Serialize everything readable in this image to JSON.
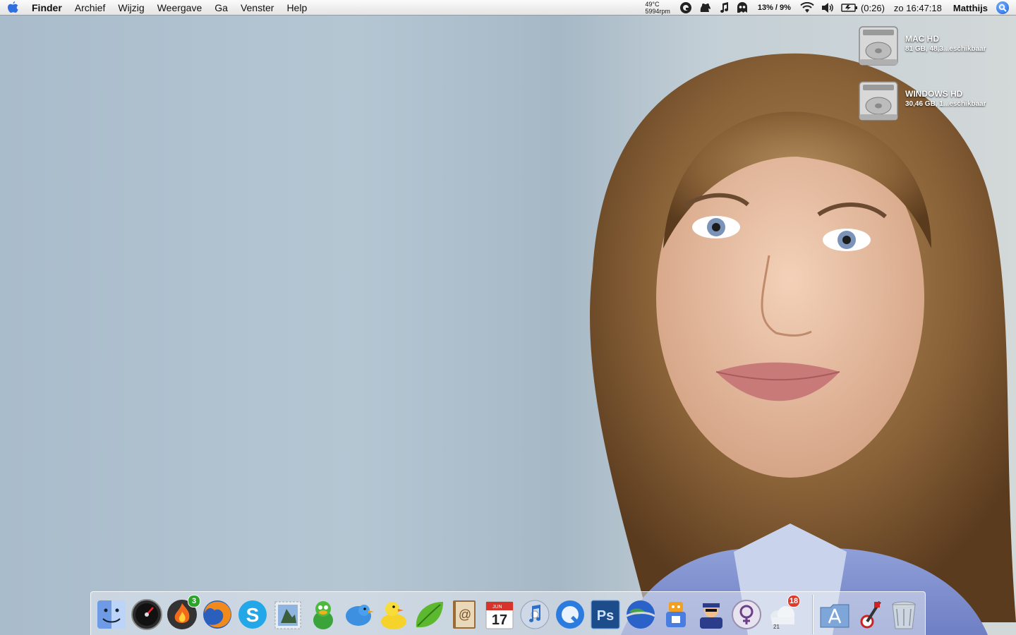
{
  "menubar": {
    "app_name": "Finder",
    "menus": [
      "Archief",
      "Wijzig",
      "Weergave",
      "Ga",
      "Venster",
      "Help"
    ],
    "temperature": "49°C",
    "fan_speed": "5994rpm",
    "cpu": "13% / 9%",
    "battery": "(0:26)",
    "clock": "zo 16:47:18",
    "user": "Matthijs",
    "status_icons": [
      "qsync-icon",
      "growl-icon",
      "music-note-icon",
      "ghost-icon",
      "wifi-icon",
      "volume-icon",
      "battery-icon"
    ]
  },
  "desktop": {
    "drives": [
      {
        "name": "MAC HD",
        "info": "81 GB, 48,3...eschikbaar"
      },
      {
        "name": "WINDOWS HD",
        "info": "30,46 GB, 1...eschikbaar"
      }
    ]
  },
  "dock": {
    "apps": [
      {
        "name": "finder",
        "icon": "finder-icon",
        "running": true
      },
      {
        "name": "dashboard",
        "icon": "dashboard-icon",
        "running": true
      },
      {
        "name": "cyberduck-fire",
        "icon": "fire-icon",
        "running": true,
        "badge": "3"
      },
      {
        "name": "firefox",
        "icon": "firefox-icon",
        "running": true
      },
      {
        "name": "skype",
        "icon": "skype-icon",
        "running": true
      },
      {
        "name": "mail-stamp",
        "icon": "stamp-icon",
        "running": true
      },
      {
        "name": "adium",
        "icon": "duck-icon",
        "running": true
      },
      {
        "name": "twitterrific",
        "icon": "bird-icon",
        "running": true
      },
      {
        "name": "cyberduck",
        "icon": "rubber-duck-icon",
        "running": true
      },
      {
        "name": "coda",
        "icon": "leaf-icon",
        "running": true
      },
      {
        "name": "address-book",
        "icon": "address-book-icon",
        "running": true
      },
      {
        "name": "ical",
        "icon": "calendar-icon",
        "running": true,
        "calendar_month": "JUN",
        "calendar_day": "17"
      },
      {
        "name": "itunes",
        "icon": "itunes-icon",
        "running": true
      },
      {
        "name": "quicktime",
        "icon": "quicktime-icon",
        "running": false
      },
      {
        "name": "photoshop",
        "icon": "photoshop-icon",
        "running": true,
        "label": "Ps"
      },
      {
        "name": "google-earth",
        "icon": "globe-icon",
        "running": false
      },
      {
        "name": "transmission",
        "icon": "robot-icon",
        "running": false
      },
      {
        "name": "cyberduck-agent",
        "icon": "agent-icon",
        "running": false
      },
      {
        "name": "gender-app",
        "icon": "venus-icon",
        "running": false
      },
      {
        "name": "weather",
        "icon": "weather-cloud-icon",
        "running": true,
        "badge": "18",
        "sub": "21"
      }
    ],
    "right_items": [
      {
        "name": "applications-folder",
        "icon": "applications-folder-icon"
      },
      {
        "name": "directory-utility",
        "icon": "compass-icon"
      },
      {
        "name": "trash",
        "icon": "trash-icon"
      }
    ]
  }
}
